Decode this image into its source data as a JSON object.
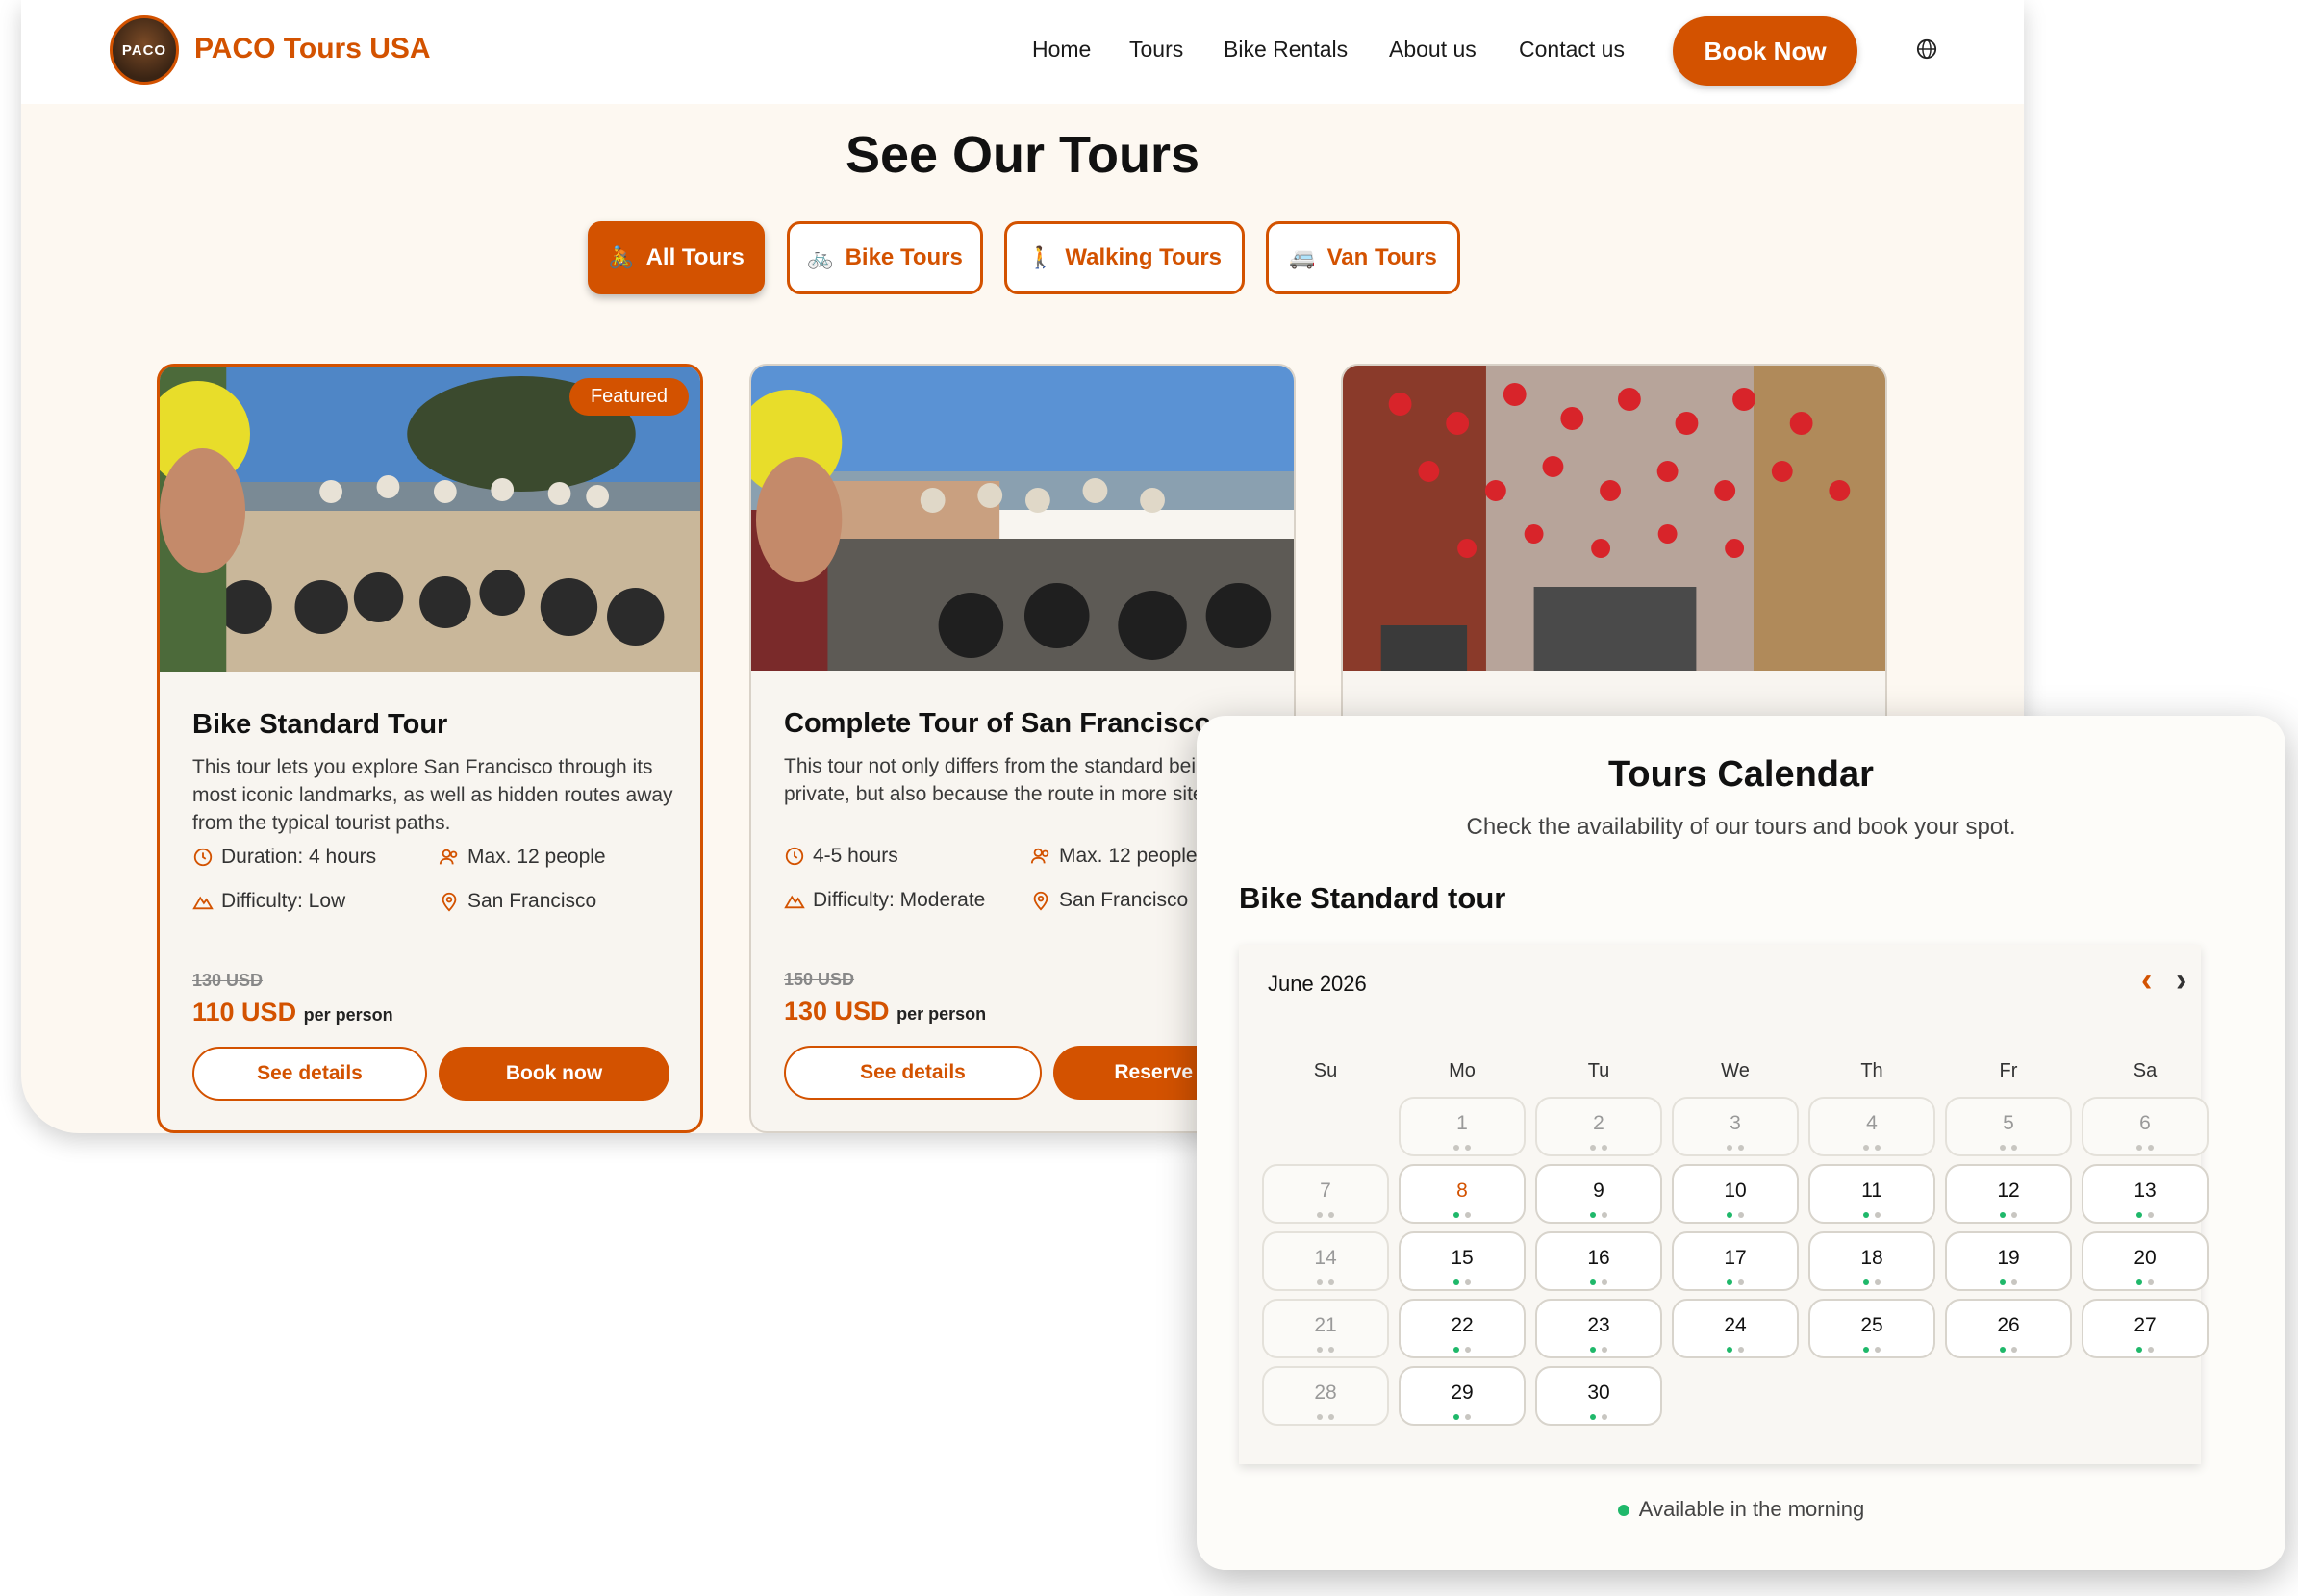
{
  "brand": {
    "logo_text": "PACO",
    "name": "PACO Tours USA"
  },
  "nav": {
    "items": [
      "Home",
      "Tours",
      "Bike Rentals",
      "About us",
      "Contact us"
    ],
    "book_now": "Book Now",
    "language_icon": "globe-icon"
  },
  "colors": {
    "accent": "#d35200",
    "available": "#1fb86a",
    "background": "#fdf8f1"
  },
  "tours_section": {
    "title": "See Our Tours",
    "filters": [
      {
        "label": "All Tours",
        "icon": "cyclist-icon",
        "active": true
      },
      {
        "label": "Bike Tours",
        "icon": "bike-icon",
        "active": false
      },
      {
        "label": "Walking Tours",
        "icon": "walking-icon",
        "active": false
      },
      {
        "label": "Van Tours",
        "icon": "van-icon",
        "active": false
      }
    ]
  },
  "cards": [
    {
      "badge": "Featured",
      "title": "Bike Standard Tour",
      "description": "This tour lets you explore San Francisco through its most iconic landmarks, as well as hidden routes away from the typical tourist paths.",
      "duration": "Duration: 4 hours",
      "group": "Max. 12 people",
      "difficulty": "Difficulty: Low",
      "location": "San Francisco",
      "old_price": "130 USD",
      "price": "110 USD",
      "per": "per person",
      "details_button": "See details",
      "action_button": "Book now"
    },
    {
      "title": "Complete Tour of San Francisco",
      "description": "This tour not only differs from the standard being private, but also because the route in more sites.",
      "duration": "4-5 hours",
      "group": "Max. 12 people",
      "difficulty": "Difficulty: Moderate",
      "location": "San Francisco",
      "old_price": "150 USD",
      "price": "130 USD",
      "per": "per person",
      "details_button": "See details",
      "action_button": "Reserve no"
    },
    {
      "title": ""
    }
  ],
  "calendar": {
    "title": "Tours Calendar",
    "subtitle": "Check the availability of our tours and book your spot.",
    "tour": "Bike Standard tour",
    "month": "June 2026",
    "weekdays": [
      "Su",
      "Mo",
      "Tu",
      "We",
      "Th",
      "Fr",
      "Sa"
    ],
    "legend": "Available in the morning",
    "days": [
      {
        "n": "1",
        "state": "inactive"
      },
      {
        "n": "2",
        "state": "inactive"
      },
      {
        "n": "3",
        "state": "inactive"
      },
      {
        "n": "4",
        "state": "inactive"
      },
      {
        "n": "5",
        "state": "inactive"
      },
      {
        "n": "6",
        "state": "inactive"
      },
      {
        "n": "7",
        "state": "inactive"
      },
      {
        "n": "8",
        "state": "today"
      },
      {
        "n": "9",
        "state": "active"
      },
      {
        "n": "10",
        "state": "active"
      },
      {
        "n": "11",
        "state": "active"
      },
      {
        "n": "12",
        "state": "active"
      },
      {
        "n": "13",
        "state": "active"
      },
      {
        "n": "14",
        "state": "inactive"
      },
      {
        "n": "15",
        "state": "active"
      },
      {
        "n": "16",
        "state": "active"
      },
      {
        "n": "17",
        "state": "active"
      },
      {
        "n": "18",
        "state": "active"
      },
      {
        "n": "19",
        "state": "active"
      },
      {
        "n": "20",
        "state": "active"
      },
      {
        "n": "21",
        "state": "inactive"
      },
      {
        "n": "22",
        "state": "active"
      },
      {
        "n": "23",
        "state": "active"
      },
      {
        "n": "24",
        "state": "active"
      },
      {
        "n": "25",
        "state": "active"
      },
      {
        "n": "26",
        "state": "active"
      },
      {
        "n": "27",
        "state": "active"
      },
      {
        "n": "28",
        "state": "inactive"
      },
      {
        "n": "29",
        "state": "active"
      },
      {
        "n": "30",
        "state": "active"
      }
    ]
  }
}
